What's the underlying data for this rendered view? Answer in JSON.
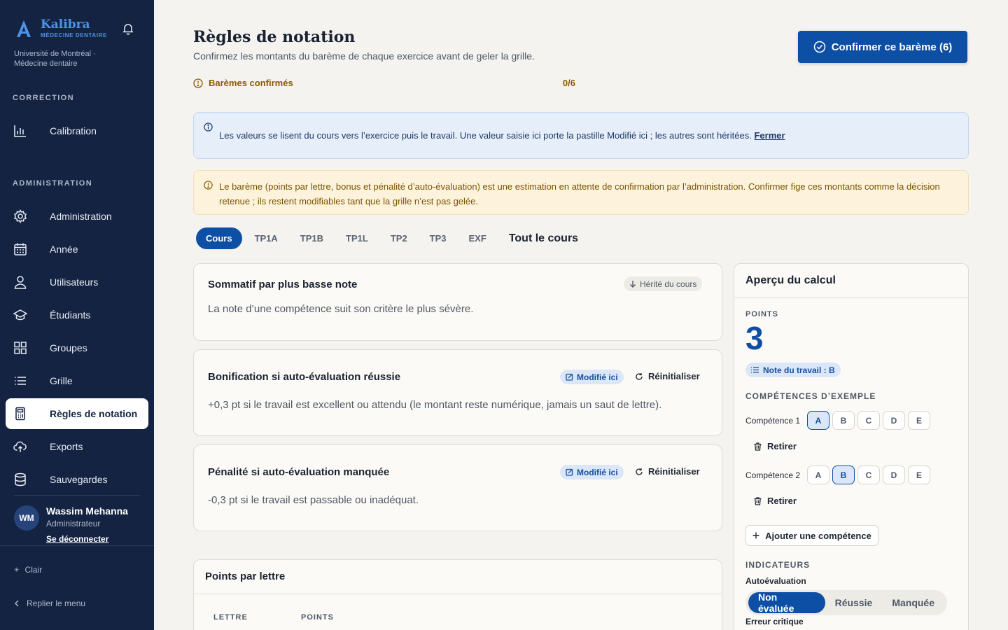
{
  "brand": {
    "name": "Kalibra",
    "subtitle": "MÉDECINE DENTAIRE",
    "university": "Université de Montréal · Médecine dentaire"
  },
  "sidebar": {
    "section_correction": "CORRECTION",
    "section_admin": "ADMINISTRATION",
    "items": [
      {
        "label": "Calibration",
        "icon": "bar-chart-icon"
      },
      {
        "label": "Administration",
        "icon": "gear-icon"
      },
      {
        "label": "Année",
        "icon": "calendar-icon"
      },
      {
        "label": "Utilisateurs",
        "icon": "user-icon"
      },
      {
        "label": "Étudiants",
        "icon": "graduation-cap-icon"
      },
      {
        "label": "Groupes",
        "icon": "grid-icon"
      },
      {
        "label": "Grille",
        "icon": "list-icon"
      },
      {
        "label": "Règles de notation",
        "icon": "calculator-icon",
        "active": true
      },
      {
        "label": "Exports",
        "icon": "cloud-upload-icon"
      },
      {
        "label": "Sauvegardes",
        "icon": "database-icon"
      }
    ],
    "user": {
      "initials": "WM",
      "name": "Wassim Mehanna",
      "role": "Administrateur",
      "logout": "Se déconnecter"
    },
    "theme": "Clair",
    "collapse": "Replier le menu"
  },
  "header": {
    "title": "Règles de notation",
    "subtitle": "Confirmez les montants du barème de chaque exercice avant de geler la grille.",
    "confirm_button": "Confirmer ce barème (6)",
    "progress_label": "Barèmes confirmés",
    "progress_count": "0/6"
  },
  "info": {
    "text": "Les valeurs se lisent du cours vers l’exercice puis le travail. Une valeur saisie ici porte la pastille Modifié ici ; les autres sont héritées.",
    "close": "Fermer"
  },
  "warning": {
    "text": "Le barème (points par lettre, bonus et pénalité d’auto-évaluation) est une estimation en attente de confirmation par l’administration. Confirmer fige ces montants comme la décision retenue ; ils restent modifiables tant que la grille n’est pas gelée."
  },
  "tabs": [
    "Cours",
    "TP1A",
    "TP1B",
    "TP1L",
    "TP2",
    "TP3",
    "EXF"
  ],
  "tab_all": "Tout le cours",
  "cards": {
    "sommatif": {
      "title": "Sommatif par plus basse note",
      "badge": "Hérité du cours",
      "desc": "La note d’une compétence suit son critère le plus sévère."
    },
    "bonus": {
      "title": "Bonification si auto-évaluation réussie",
      "badge": "Modifié ici",
      "reset": "Réinitialiser",
      "desc": "+0,3 pt si le travail est excellent ou attendu (le montant reste numérique, jamais un saut de lettre)."
    },
    "penalty": {
      "title": "Pénalité si auto-évaluation manquée",
      "badge": "Modifié ici",
      "reset": "Réinitialiser",
      "desc": "-0,3 pt si le travail est passable ou inadéquat."
    }
  },
  "points_table": {
    "title": "Points par lettre",
    "col_letter": "LETTRE",
    "col_points": "POINTS"
  },
  "preview": {
    "title": "Aperçu du calcul",
    "points_label": "POINTS",
    "points_value": "3",
    "grade_badge": "Note du travail : B",
    "examples_label": "COMPÉTENCES D’EXEMPLE",
    "letters": [
      "A",
      "B",
      "C",
      "D",
      "E"
    ],
    "competences": [
      {
        "label": "Compétence 1",
        "selected": "A"
      },
      {
        "label": "Compétence 2",
        "selected": "B"
      }
    ],
    "remove": "Retirer",
    "add": "Ajouter une compétence",
    "indicators_label": "INDICATEURS",
    "autoeval_label": "Autoévaluation",
    "autoeval_options": [
      "Non évaluée",
      "Réussie",
      "Manquée"
    ],
    "autoeval_selected": "Non évaluée",
    "critical_label": "Erreur critique"
  },
  "colors": {
    "sidebar": "#142342",
    "accent": "#0e4fa6",
    "warning_bg": "#fdf3dd",
    "info_bg": "#e6eef9"
  }
}
